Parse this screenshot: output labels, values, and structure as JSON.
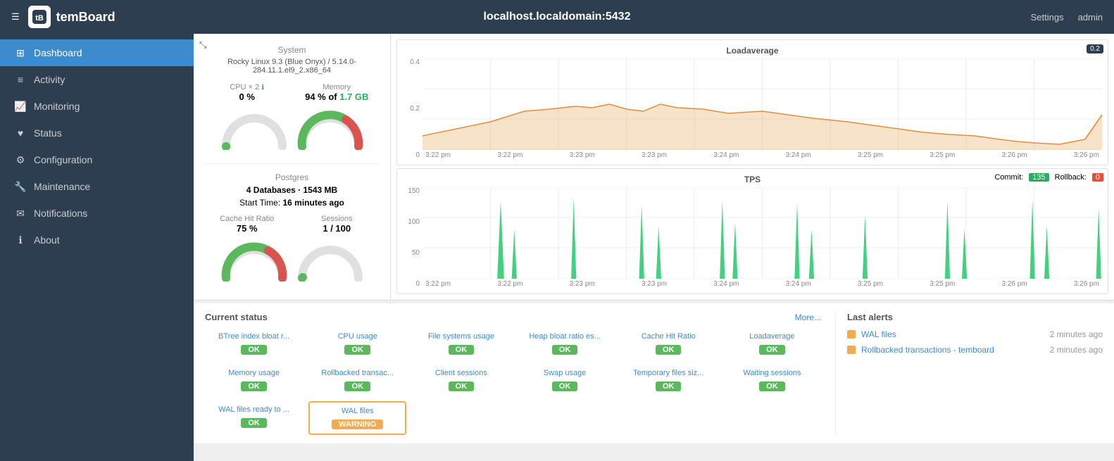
{
  "app": {
    "title": "localhost.localdomain:5432",
    "settings_label": "Settings",
    "admin_label": "admin",
    "logo_text": "tB"
  },
  "sidebar": {
    "items": [
      {
        "id": "dashboard",
        "label": "Dashboard",
        "icon": "⊞",
        "active": true
      },
      {
        "id": "activity",
        "label": "Activity",
        "icon": "≡"
      },
      {
        "id": "monitoring",
        "label": "Monitoring",
        "icon": "📊"
      },
      {
        "id": "status",
        "label": "Status",
        "icon": "♥"
      },
      {
        "id": "configuration",
        "label": "Configuration",
        "icon": "⚙"
      },
      {
        "id": "maintenance",
        "label": "Maintenance",
        "icon": "🔧"
      },
      {
        "id": "notifications",
        "label": "Notifications",
        "icon": "✉"
      },
      {
        "id": "about",
        "label": "About",
        "icon": "ℹ"
      }
    ]
  },
  "system": {
    "section_title": "System",
    "os": "Rocky Linux 9.3 (Blue Onyx) / 5.14.0-284.11.1.el9_2.x86_64",
    "cpu_label": "CPU × 2",
    "cpu_value": "0 %",
    "memory_label": "Memory",
    "memory_value": "94 % of 1.7 GB",
    "cpu_gauge_pct": 0,
    "memory_gauge_pct": 94
  },
  "postgres": {
    "section_title": "Postgres",
    "databases": "4 Databases · 1543 MB",
    "start_time": "Start Time: 16 minutes ago",
    "cache_hit_label": "Cache Hit Ratio",
    "cache_hit_value": "75 %",
    "sessions_label": "Sessions",
    "sessions_value": "1 / 100",
    "cache_gauge_pct": 75,
    "sessions_gauge_pct": 1
  },
  "loadaverage_chart": {
    "title": "Loadaverage",
    "badge": "0.2",
    "y_labels": [
      "0.4",
      "0.2",
      "0"
    ],
    "x_labels": [
      "3:22 pm",
      "3:22 pm",
      "3:23 pm",
      "3:23 pm",
      "3:24 pm",
      "3:24 pm",
      "3:25 pm",
      "3:25 pm",
      "3:26 pm",
      "3:26 pm"
    ]
  },
  "tps_chart": {
    "title": "TPS",
    "commit_label": "Commit:",
    "commit_value": "135",
    "rollback_label": "Rollback:",
    "rollback_value": "0",
    "y_labels": [
      "150",
      "100",
      "50",
      "0"
    ],
    "x_labels": [
      "3:22 pm",
      "3:22 pm",
      "3:23 pm",
      "3:23 pm",
      "3:24 pm",
      "3:24 pm",
      "3:25 pm",
      "3:25 pm",
      "3:26 pm",
      "3:26 pm"
    ]
  },
  "current_status": {
    "title": "Current status",
    "more_label": "More...",
    "items": [
      {
        "label": "BTree index bloat r...",
        "badge": "OK",
        "status": "ok"
      },
      {
        "label": "CPU usage",
        "badge": "OK",
        "status": "ok"
      },
      {
        "label": "File systems usage",
        "badge": "OK",
        "status": "ok"
      },
      {
        "label": "Heap bloat ratio es...",
        "badge": "OK",
        "status": "ok"
      },
      {
        "label": "Cache Hit Ratio",
        "badge": "OK",
        "status": "ok"
      },
      {
        "label": "Loadaverage",
        "badge": "OK",
        "status": "ok"
      },
      {
        "label": "Memory usage",
        "badge": "OK",
        "status": "ok"
      },
      {
        "label": "Rollbacked transac...",
        "badge": "OK",
        "status": "ok"
      },
      {
        "label": "Client sessions",
        "badge": "OK",
        "status": "ok"
      },
      {
        "label": "Swap usage",
        "badge": "OK",
        "status": "ok"
      },
      {
        "label": "Temporary files siz...",
        "badge": "OK",
        "status": "ok"
      },
      {
        "label": "Waiting sessions",
        "badge": "OK",
        "status": "ok"
      },
      {
        "label": "WAL files ready to ...",
        "badge": "OK",
        "status": "ok"
      },
      {
        "label": "WAL files",
        "badge": "WARNING",
        "status": "warning"
      }
    ]
  },
  "last_alerts": {
    "title": "Last alerts",
    "items": [
      {
        "label": "WAL files",
        "time": "2 minutes ago",
        "color": "warning"
      },
      {
        "label": "Rollbacked transactions - temboard",
        "time": "2 minutes ago",
        "color": "warning"
      }
    ]
  }
}
